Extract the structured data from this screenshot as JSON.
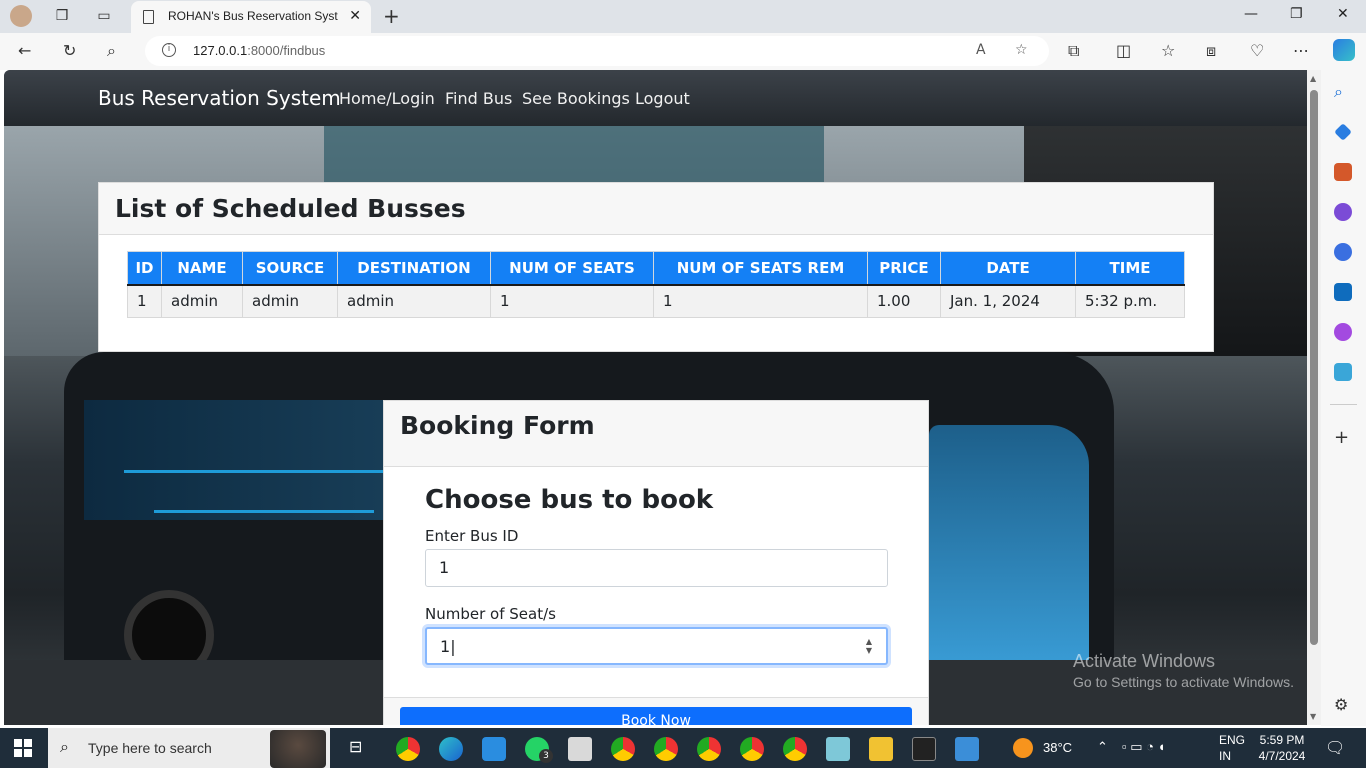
{
  "browser": {
    "tab_title": "ROHAN's Bus Reservation System",
    "url_host": "127.0.0.1",
    "url_path": ":8000/findbus",
    "new_tab_symbol": "+",
    "tab_close_symbol": "✕"
  },
  "site": {
    "brand": "Bus Reservation System",
    "nav": [
      "Home/Login",
      "Find Bus",
      "See Bookings",
      "Logout"
    ]
  },
  "schedule": {
    "title": "List of Scheduled Busses",
    "columns": [
      "ID",
      "NAME",
      "SOURCE",
      "DESTINATION",
      "NUM OF SEATS",
      "NUM OF SEATS REM",
      "PRICE",
      "DATE",
      "TIME"
    ],
    "rows": [
      [
        "1",
        "admin",
        "admin",
        "admin",
        "1",
        "1",
        "1.00",
        "Jan. 1, 2024",
        "5:32 p.m."
      ]
    ]
  },
  "booking": {
    "title": "Booking Form",
    "heading": "Choose bus to book",
    "bus_id_label": "Enter Bus ID",
    "bus_id_value": "1",
    "seats_label": "Number of Seat/s",
    "seats_value": "1",
    "button": "Book Now"
  },
  "watermark": {
    "line1": "Activate Windows",
    "line2": "Go to Settings to activate Windows."
  },
  "taskbar": {
    "search_placeholder": "Type here to search",
    "weather": "38°C",
    "lang1": "ENG",
    "lang2": "IN",
    "time": "5:59 PM",
    "date": "4/7/2024",
    "whatsapp_badge": "3"
  },
  "colors": {
    "primary": "#0d6efd",
    "table_header": "#1480f5",
    "navbar": "#2b3035"
  }
}
